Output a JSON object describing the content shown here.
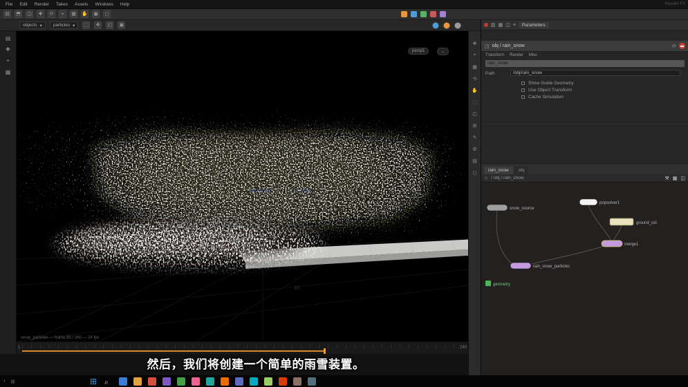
{
  "window": {
    "title_hint": "Houdini FX"
  },
  "menus": [
    "File",
    "Edit",
    "Render",
    "Takes",
    "Assets",
    "Windows",
    "Help"
  ],
  "toolbar": {
    "mode1": "objects",
    "mode2": "particles",
    "icons1": [
      "▤",
      "⬒",
      "◫",
      "✚",
      "⟳",
      "⌖",
      "▦",
      "✋",
      "▣",
      "◻"
    ],
    "icons2": [
      "⬚",
      "✥",
      "◰",
      "▣"
    ],
    "accent_colors": [
      "#e8963c",
      "#4f9bd6",
      "#58b368",
      "#c75b5b",
      "#a57fd0"
    ],
    "round_colors": [
      "#4f9bd6",
      "#e8963c",
      "#9a9a9a"
    ]
  },
  "left_rail": {
    "icons": [
      "▤",
      "✚",
      "⌖",
      "▦"
    ]
  },
  "right_rail": {
    "icons": [
      "✥",
      "⌖",
      "▦",
      "⟲",
      "✋",
      "⬚",
      "◰",
      "⊞",
      "✎",
      "⚙",
      "▤",
      "◻"
    ]
  },
  "viewport": {
    "pill1": "persp1",
    "pill2": "⌄",
    "watermark": "WWW.·····.COM",
    "grid_label": "85",
    "status": "snow_particles — frame 85 / 240 — 24 fps",
    "particle_color": "#ded6c2"
  },
  "timeline": {
    "start": "1",
    "end": "240",
    "progress_color": "#d8872b"
  },
  "right_panel": {
    "pane_tab": "Parameters",
    "pane_icons": [
      "▥",
      "▦",
      "◫",
      "≡"
    ],
    "header": "obj / rain_snow",
    "header_icons": [
      "◳",
      "⟳"
    ],
    "param_tabs": [
      "Transform",
      "Render",
      "Misc"
    ],
    "name_value": "rain_snow",
    "path_label": "Path",
    "path_value": "/obj/rain_snow",
    "checks": [
      "Show Guide Geometry",
      "Use Object Transform",
      "Cache Simulation"
    ],
    "net_tab1": "rain_snow",
    "net_tab2": "obj",
    "net_path": "/ obj / rain_snow",
    "net_icons": [
      "⚒",
      "▦",
      "◫"
    ],
    "nodes": [
      {
        "label": "snow_source",
        "color": "#9f9f9f"
      },
      {
        "label": "popsolver1",
        "color": "#f2f2f2"
      },
      {
        "label": "ground_col",
        "color": "#e9e2bd"
      },
      {
        "label": "merge1",
        "color": "#c29add"
      },
      {
        "label": "rain_snow_particles",
        "color": "#c29add"
      },
      {
        "label": "geometry",
        "color": "#49b858"
      }
    ]
  },
  "subtitle": "然后，我们将创建一个简单的雨雪装置。",
  "taskbar": {
    "win_glyph": "⊞",
    "search_glyph": "⌕",
    "icon_colors": [
      "#3a7bd5",
      "#e2a33d",
      "#d94f3d",
      "#7e57c2",
      "#43a047",
      "#f06292",
      "#26a69a",
      "#ef6c00",
      "#5c6bc0",
      "#00acc1",
      "#9ccc65",
      "#d83b01",
      "#8d6e63",
      "#546e7a"
    ]
  }
}
